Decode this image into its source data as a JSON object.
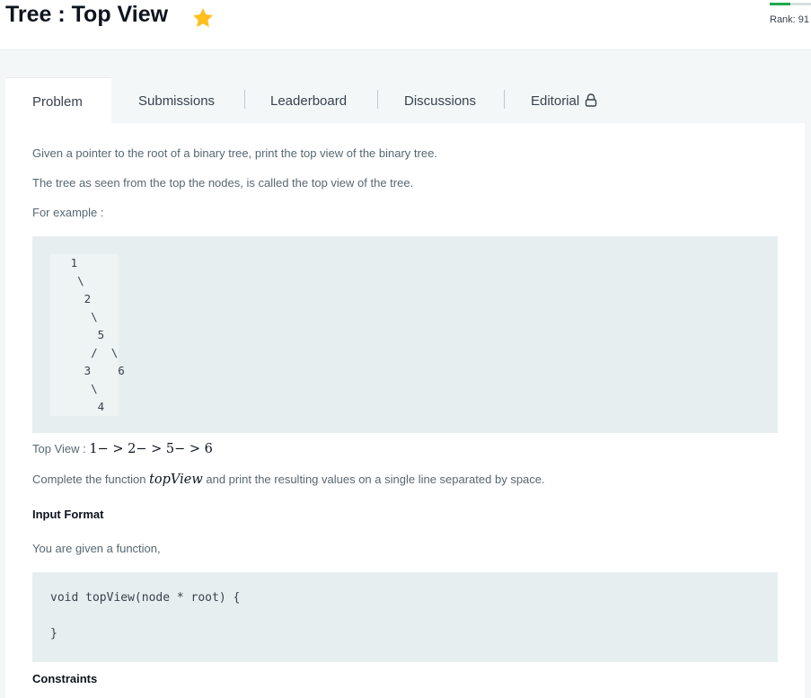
{
  "header": {
    "title": "Tree : Top View",
    "star_icon": "star-icon",
    "star_color": "#ffc01e",
    "rank_label": "Rank: 91",
    "rank_progress": 0.5,
    "rank_progress_color": "#1ba94c"
  },
  "tabs": [
    {
      "label": "Problem",
      "active": true
    },
    {
      "label": "Submissions",
      "active": false
    },
    {
      "label": "Leaderboard",
      "active": false
    },
    {
      "label": "Discussions",
      "active": false
    },
    {
      "label": "Editorial",
      "active": false,
      "icon": "lock-icon"
    }
  ],
  "problem": {
    "intro": "Given a pointer to the root of a binary tree, print the top view of the binary tree.",
    "definition": "The tree as seen from the top the nodes, is called the top view of the tree.",
    "example_label": "For example :",
    "tree_lines": [
      "   1",
      "    \\",
      "     2",
      "      \\",
      "       5",
      "      /  \\",
      "     3    6",
      "      \\",
      "       4"
    ],
    "top_view_label": "Top View : ",
    "top_view_value": "1− > 2− > 5− > 6",
    "complete_prefix": "Complete the function ",
    "complete_func": "topView",
    "complete_suffix": " and print the resulting values on a single line separated by space.",
    "input_format_heading": "Input Format",
    "given_function": "You are given a function,",
    "code_lines": [
      "void topView(node * root) {",
      "",
      "}"
    ],
    "next_heading": "Constraints"
  }
}
